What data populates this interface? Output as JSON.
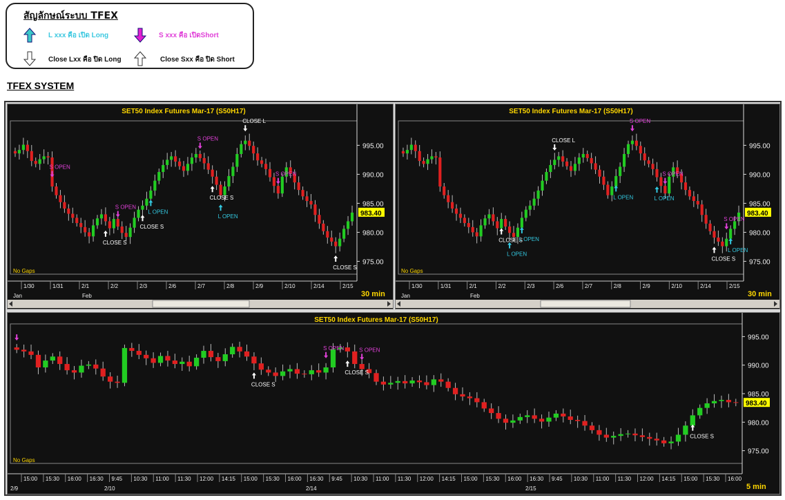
{
  "legend": {
    "title": "สัญลักษณ์ระบบ TFEX",
    "items": [
      {
        "icon": "cyan-up-arrow-icon",
        "label": "L xxx คือ เปิด Long",
        "color": "#3cc8e0"
      },
      {
        "icon": "magenta-down-arrow-icon",
        "label": "S xxx คือ เปิดShort",
        "color": "#e040d8"
      },
      {
        "icon": "hollow-down-arrow-icon",
        "label": "Close Lxx คือ ปิด Long",
        "color": "#111111"
      },
      {
        "icon": "hollow-up-arrow-icon",
        "label": "Close Sxx คือ ปิด Short",
        "color": "#111111"
      }
    ]
  },
  "system_title": "TFEX SYSTEM",
  "chart_data": [
    {
      "type": "candlestick",
      "title": "SET50  Index  Futures  Mar-17  (S50H17)",
      "timeframe": "30  min",
      "gap_note": "No  Gaps",
      "ylim": [
        973.5,
        998.5
      ],
      "yticks": [
        "995.00",
        "990.00",
        "985.00",
        "980.00",
        "975.00"
      ],
      "last_price": "983.40",
      "xticks": [
        "1/30",
        "1/31",
        "2/1",
        "2/2",
        "2/3",
        "2/6",
        "2/7",
        "2/8",
        "2/9",
        "2/10",
        "2/14",
        "2/15"
      ],
      "months": [
        "Jan",
        "Feb"
      ],
      "closes": [
        993.6,
        994.2,
        995.1,
        994.0,
        992.3,
        991.8,
        992.6,
        993.1,
        992.9,
        987.9,
        986.4,
        985.2,
        984.1,
        983.2,
        982.5,
        981.6,
        980.9,
        980.0,
        979.3,
        981.2,
        982.4,
        983.1,
        981.9,
        980.7,
        982.3,
        981.0,
        979.9,
        979.2,
        980.8,
        982.5,
        983.9,
        984.6,
        985.8,
        987.2,
        988.9,
        990.4,
        991.6,
        992.5,
        993.1,
        992.2,
        991.4,
        990.6,
        991.8,
        992.9,
        993.5,
        992.8,
        991.9,
        990.8,
        989.6,
        988.2,
        986.4,
        987.9,
        989.7,
        991.3,
        993.5,
        995.2,
        995.8,
        994.9,
        993.6,
        992.4,
        991.8,
        990.9,
        989.5,
        988.0,
        986.7,
        989.6,
        991.2,
        990.1,
        988.6,
        987.3,
        986.2,
        985.4,
        984.8,
        983.0,
        981.5,
        980.2,
        979.1,
        978.4,
        977.6,
        978.9,
        980.6,
        981.9,
        983.4
      ],
      "markers": [
        {
          "label": "S  OPEN",
          "kind": "sopen",
          "i": 9
        },
        {
          "label": "CLOSE  S",
          "kind": "closes",
          "i": 22
        },
        {
          "label": "S  OPEN",
          "kind": "sopen",
          "i": 25
        },
        {
          "label": "CLOSE  S",
          "kind": "closes",
          "i": 31
        },
        {
          "label": "L  OPEN",
          "kind": "lopen",
          "i": 33
        },
        {
          "label": "S  OPEN",
          "kind": "sopen",
          "i": 45
        },
        {
          "label": "CLOSE  S",
          "kind": "closes",
          "i": 48
        },
        {
          "label": "L  OPEN",
          "kind": "lopen",
          "i": 50
        },
        {
          "label": "CLOSE  L",
          "kind": "closel",
          "i": 56
        },
        {
          "label": "S  OPEN",
          "kind": "sopen",
          "i": 64
        },
        {
          "label": "CLOSE  S",
          "kind": "closes",
          "i": 78
        }
      ]
    },
    {
      "type": "candlestick",
      "title": "SET50  Index  Futures  Mar-17  (S50H17)",
      "timeframe": "30  min",
      "gap_note": "No  Gaps",
      "ylim": [
        973.5,
        998.5
      ],
      "yticks": [
        "995.00",
        "990.00",
        "985.00",
        "980.00",
        "975.00"
      ],
      "last_price": "983.40",
      "xticks": [
        "1/30",
        "1/31",
        "2/1",
        "2/2",
        "2/3",
        "2/6",
        "2/7",
        "2/8",
        "2/9",
        "2/10",
        "2/14",
        "2/15"
      ],
      "months": [
        "Jan",
        "Feb"
      ],
      "closes": [
        993.6,
        994.2,
        995.1,
        994.0,
        992.3,
        991.8,
        992.6,
        993.1,
        992.9,
        987.9,
        986.4,
        985.2,
        984.1,
        983.2,
        982.5,
        981.6,
        980.9,
        980.0,
        979.3,
        981.2,
        982.4,
        983.1,
        981.9,
        980.7,
        982.3,
        981.0,
        979.9,
        979.2,
        980.8,
        982.5,
        983.9,
        984.6,
        985.8,
        987.2,
        988.9,
        990.4,
        991.6,
        992.5,
        993.1,
        992.2,
        991.4,
        990.6,
        991.8,
        992.9,
        993.5,
        992.8,
        991.9,
        990.8,
        989.6,
        988.2,
        986.4,
        987.9,
        989.7,
        991.3,
        993.5,
        995.2,
        995.8,
        994.9,
        993.6,
        992.4,
        991.8,
        990.9,
        989.5,
        988.0,
        986.7,
        989.6,
        991.2,
        990.1,
        988.6,
        987.3,
        986.2,
        985.4,
        984.8,
        983.0,
        981.5,
        980.2,
        979.1,
        978.4,
        977.6,
        978.9,
        980.6,
        981.9,
        983.4
      ],
      "markers": [
        {
          "label": "CLOSE  S",
          "kind": "closes",
          "i": 24
        },
        {
          "label": "L  OPEN",
          "kind": "lopen",
          "i": 26
        },
        {
          "label": "L  OPEN",
          "kind": "lopen",
          "i": 29
        },
        {
          "label": "CLOSE  L",
          "kind": "closel",
          "i": 37
        },
        {
          "label": "L  OPEN",
          "kind": "lopen",
          "i": 52
        },
        {
          "label": "S  OPEN",
          "kind": "sopen",
          "i": 56
        },
        {
          "label": "S  OPEN",
          "kind": "sopen",
          "i": 64
        },
        {
          "label": "L  OPEN",
          "kind": "lopen",
          "i": 62
        },
        {
          "label": "CLOSE  S",
          "kind": "closes",
          "i": 76
        },
        {
          "label": "S  OPEN",
          "kind": "sopen",
          "i": 79
        },
        {
          "label": "L  OPEN",
          "kind": "lopen",
          "i": 80
        }
      ]
    },
    {
      "type": "candlestick",
      "title": "SET50  Index  Futures  Mar-17  (S50H17)",
      "timeframe": "5  min",
      "gap_note": "No  Gaps",
      "ylim": [
        973.5,
        996.5
      ],
      "yticks": [
        "995.00",
        "990.00",
        "985.00",
        "980.00",
        "975.00"
      ],
      "last_price": "983.40",
      "xticks": [
        "15:00",
        "15:30",
        "16:00",
        "16:30",
        "9:45",
        "10:30",
        "11:00",
        "11:30",
        "12:00",
        "14:15",
        "15:00",
        "15:30",
        "16:00",
        "16:30",
        "9:45",
        "10:30",
        "11:00",
        "11:30",
        "12:00",
        "14:15",
        "15:00",
        "15:30",
        "16:00",
        "16:30",
        "9:45",
        "10:30",
        "11:00",
        "11:30",
        "12:00",
        "14:15",
        "15:00",
        "15:30",
        "16:00"
      ],
      "dates": [
        "2/9",
        "2/10",
        "2/14",
        "2/15"
      ],
      "closes": [
        992.7,
        992.4,
        991.8,
        989.6,
        990.8,
        991.5,
        990.2,
        989.1,
        988.7,
        989.9,
        990.1,
        989.4,
        988.0,
        987.1,
        986.9,
        993.0,
        992.5,
        991.8,
        991.2,
        990.4,
        991.6,
        990.8,
        990.2,
        990.6,
        989.8,
        991.3,
        992.5,
        991.4,
        990.7,
        991.9,
        993.2,
        992.4,
        991.5,
        990.3,
        989.2,
        988.7,
        988.1,
        988.9,
        989.3,
        988.5,
        988.4,
        989.1,
        988.7,
        989.6,
        992.8,
        993.1,
        992.4,
        990.2,
        989.3,
        988.6,
        987.1,
        986.6,
        986.9,
        987.2,
        986.8,
        987.3,
        987.0,
        986.5,
        987.5,
        987.1,
        986.0,
        984.9,
        984.5,
        984.2,
        983.5,
        982.4,
        981.6,
        980.6,
        979.9,
        980.3,
        980.9,
        981.2,
        980.6,
        980.1,
        980.8,
        981.5,
        981.0,
        980.4,
        980.2,
        979.4,
        978.6,
        977.8,
        977.3,
        977.6,
        977.9,
        978.0,
        977.7,
        977.4,
        977.1,
        976.8,
        976.3,
        976.6,
        977.8,
        979.4,
        981.2,
        982.5,
        983.3,
        983.7,
        983.9,
        983.5,
        983.4
      ],
      "markers": [
        {
          "label": "",
          "kind": "sopen",
          "i": 0
        },
        {
          "label": "CLOSE  S",
          "kind": "closes",
          "i": 33
        },
        {
          "label": "S  OPEN",
          "kind": "sopen",
          "i": 43
        },
        {
          "label": "CLOSE  S",
          "kind": "closes",
          "i": 46
        },
        {
          "label": "S  OPEN",
          "kind": "sopen",
          "i": 48
        },
        {
          "label": "CLOSE  S",
          "kind": "closes",
          "i": 94
        }
      ]
    }
  ]
}
